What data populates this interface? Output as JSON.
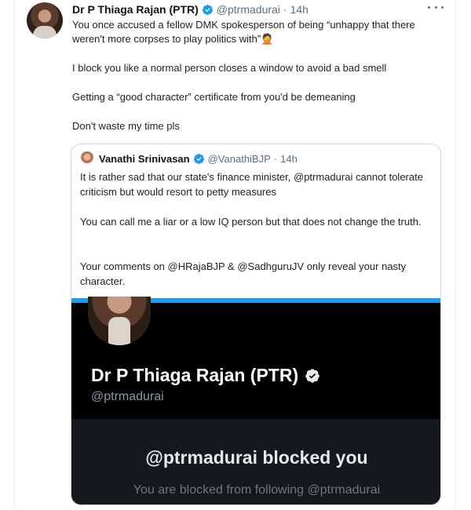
{
  "tweet": {
    "display_name": "Dr P Thiaga Rajan (PTR)",
    "handle": "@ptrmadurai",
    "separator": "·",
    "time": "14h",
    "paragraphs": [
      "You once accused a fellow DMK spokesperson of being “unhappy that there weren't more corpses to play politics with”🤦",
      "I block you like a normal person closes a window to avoid a bad smell",
      "Getting a “good character” certificate from you'd be demeaning",
      "Don't waste my time pls"
    ],
    "verified_icon": "verified-badge-icon",
    "more_icon": "more-options-icon"
  },
  "quoted": {
    "display_name": "Vanathi Srinivasan",
    "handle": "@VanathiBJP",
    "separator": "·",
    "time": "14h",
    "paragraphs": [
      "It is rather sad that our state's finance minister, @ptrmadurai cannot tolerate criticism but would resort to petty measures",
      "You can call me a liar or a low IQ person but that does not change the truth.",
      "Your comments on @HRajaBJP & @SadhguruJV only reveal your nasty character."
    ],
    "screenshot": {
      "profile_name": "Dr P Thiaga Rajan (PTR)",
      "profile_handle": "@ptrmadurai",
      "blocked_title": "@ptrmadurai blocked you",
      "blocked_subtitle": "You are blocked from following @ptrmadurai"
    }
  },
  "colors": {
    "accent": "#1d9bf0",
    "secondary_text": "#5b7083",
    "dark_bg": "#15181c"
  }
}
